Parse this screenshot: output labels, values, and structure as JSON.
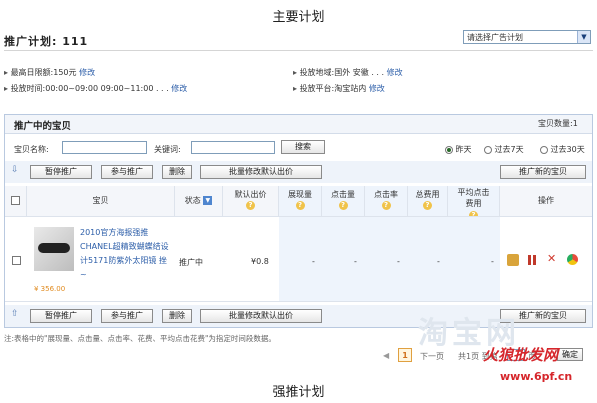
{
  "captions": {
    "top": "主要计划",
    "bottom": "强推计划"
  },
  "plan": {
    "title": "推广计划:  111",
    "select_value": "请选择广告计划"
  },
  "info": {
    "budget_label": "最高日限额:150元",
    "budget_edit": "修改",
    "region_label": "投放地域:国外 安徽 . . .",
    "region_edit": "修改",
    "time_label": "投放时间:00:00~09:00  09:00~11:00 . . .",
    "time_edit": "修改",
    "platform_label": "投放平台:淘宝站内",
    "platform_edit": "修改"
  },
  "panel": {
    "title": "推广中的宝贝",
    "count": "宝贝数量:1"
  },
  "search": {
    "name_label": "宝贝名称:",
    "keyword_label": "关键词:",
    "search_button": "搜索",
    "ranges": [
      "昨天",
      "过去7天",
      "过去30天"
    ],
    "selected_range": "昨天"
  },
  "toolbar": {
    "pause": "暂停推广",
    "join": "参与推广",
    "delete": "删除",
    "batch_price": "批量修改默认出价",
    "new_item": "推广新的宝贝"
  },
  "table": {
    "headers": {
      "item": "宝贝",
      "status": "状态",
      "bid": "默认出价",
      "impressions": "展现量",
      "clicks": "点击量",
      "ctr": "点击率",
      "cost": "总费用",
      "avg_cpc": "平均点击费用",
      "actions": "操作"
    },
    "row": {
      "title": "2010官方海报强推 CHANEL超精致蝴蝶结设计5171防紫外太阳镜 挫~",
      "price": "¥ 356.00",
      "status": "推广中",
      "bid": "¥0.8",
      "impressions": "-",
      "clicks": "-",
      "ctr": "-",
      "cost": "-",
      "avg_cpc": "-"
    }
  },
  "note": "注:表格中的\"展现量、点击量、点击率、花费、平均点击花费\"为指定时间段数据。",
  "pager": {
    "current": "1",
    "next": "下一页",
    "total": "共1页 到第",
    "page_unit": "页",
    "ok": "确定"
  },
  "watermark": {
    "text": "淘宝网",
    "site_text": "火狼批发网",
    "site_url": "www.6pf.cn"
  },
  "colors": {
    "link": "#2b5da8",
    "header_bg": "#f2f5fa",
    "watermark_red": "#d6262b"
  }
}
